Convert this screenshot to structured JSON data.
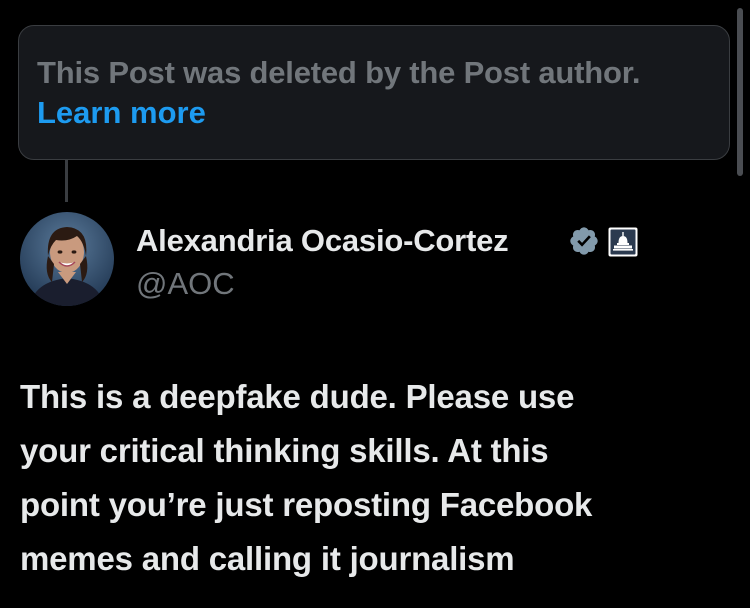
{
  "deleted_notice": {
    "text": "This Post was deleted by the Post author.",
    "link_label": "Learn more"
  },
  "author": {
    "name": "Alexandria Ocasio-Cortez",
    "handle": "@AOC",
    "verified_icon": "verified-badge-icon",
    "affiliation_icon": "capitol-building-icon"
  },
  "post": {
    "text": "This is a deepfake dude. Please use\nyour critical thinking skills. At this\npoint you’re just reposting Facebook\nmemes and calling it journalism"
  },
  "colors": {
    "background": "#000000",
    "primary_text": "#e7e9ea",
    "secondary_text": "#71767b",
    "link": "#1d9bf0",
    "verified_badge": "#829aab",
    "box_border": "#3a3d41"
  }
}
